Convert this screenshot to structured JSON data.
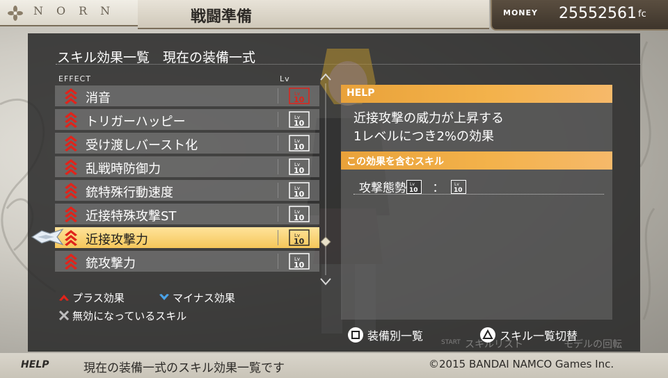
{
  "header": {
    "brand": "NORN",
    "screen_title": "戦闘準備",
    "money_label": "MONEY",
    "money_value": "25552561",
    "money_unit": "fc"
  },
  "panel": {
    "title": "スキル効果一覧　現在の装備一式",
    "col_effect": "EFFECT",
    "col_lv": "Lv"
  },
  "effects": [
    {
      "name": "消音",
      "lv": "10"
    },
    {
      "name": "トリガーハッピー",
      "lv": "10"
    },
    {
      "name": "受け渡しバースト化",
      "lv": "10"
    },
    {
      "name": "乱戦時防御力",
      "lv": "10"
    },
    {
      "name": "銃特殊行動速度",
      "lv": "10"
    },
    {
      "name": "近接特殊攻撃ST",
      "lv": "10"
    },
    {
      "name": "近接攻撃力",
      "lv": "10"
    },
    {
      "name": "銃攻撃力",
      "lv": "10"
    }
  ],
  "legend": {
    "plus": "プラス効果",
    "minus": "マイナス効果",
    "disabled": "無効になっているスキル"
  },
  "help": {
    "header": "HELP",
    "line1": "近接攻撃の威力が上昇する",
    "line2": "1レベルにつき2%の効果",
    "skills_header": "この効果を含むスキル",
    "skill_name": "攻撃態勢",
    "skill_lv": "10",
    "skill_sep": "：",
    "skill_total": "10"
  },
  "buttons": {
    "by_equipment": "装備別一覧",
    "toggle_list": "スキル一覧切替",
    "start": "START",
    "skill_list": "スキルリスト",
    "model_rotate": "モデルの回転"
  },
  "footer": {
    "help_tag": "HELP",
    "help_text": "現在の装備一式のスキル効果一覧です",
    "copyright": "©2015 BANDAI NAMCO Games Inc."
  },
  "colors": {
    "accent_orange": "#f3b24b",
    "selected_row": "#f5c65a",
    "plus_red": "#e0241b",
    "minus_blue": "#4aa3e8"
  },
  "selected_index": 6
}
